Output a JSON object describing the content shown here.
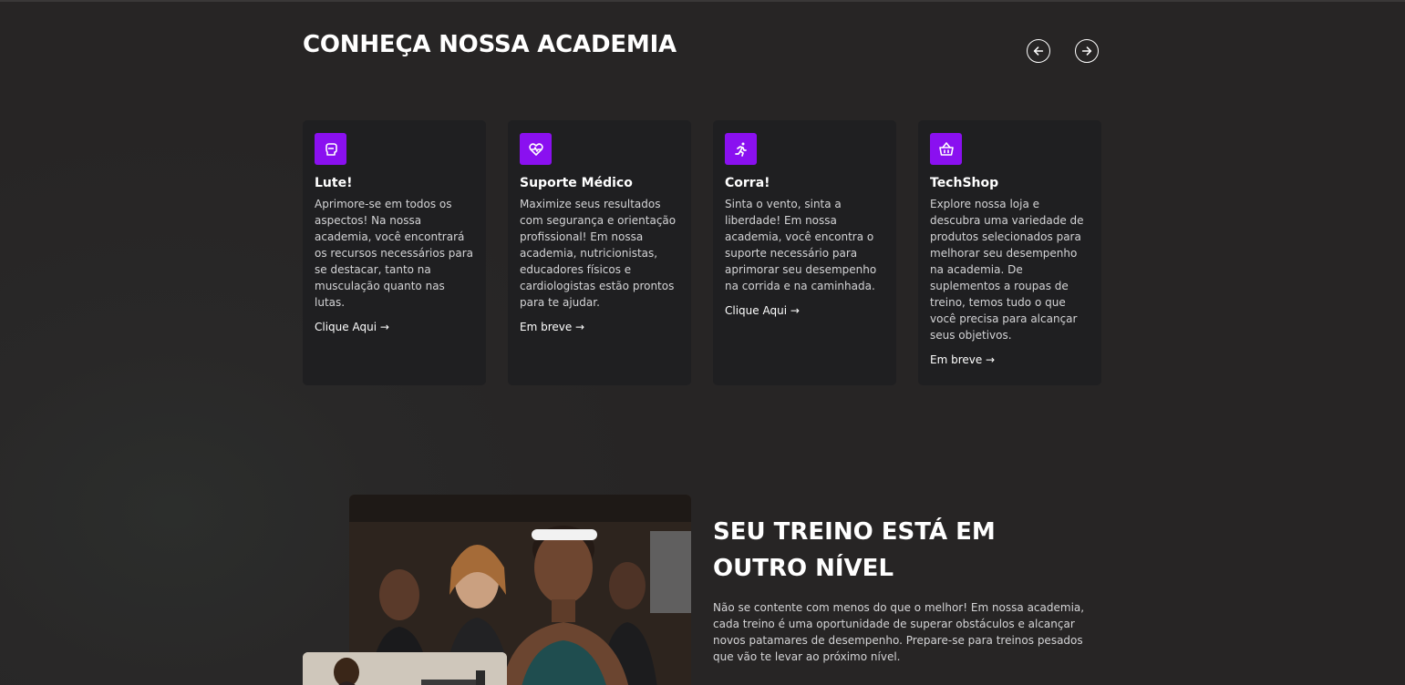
{
  "section": {
    "title": "CONHEÇA NOSSA ACADEMIA"
  },
  "carousel": {
    "prev_icon": "arrow-left-icon",
    "next_icon": "arrow-right-icon"
  },
  "cards": [
    {
      "icon": "boxing-glove-icon",
      "title": "Lute!",
      "text": "Aprimore-se em todos os aspectos! Na nossa academia, você encontrará os recursos necessários para se destacar, tanto na musculação quanto nas lutas.",
      "link": "Clique Aqui →"
    },
    {
      "icon": "heart-pulse-icon",
      "title": "Suporte Médico",
      "text": "Maximize seus resultados com segurança e orientação profissional! Em nossa academia, nutricionistas, educadores físicos e cardiologistas estão prontos para te ajudar.",
      "link": "Em breve →"
    },
    {
      "icon": "running-person-icon",
      "title": "Corra!",
      "text": "Sinta o vento, sinta a liberdade! Em nossa academia, você encontra o suporte necessário para aprimorar seu desempenho na corrida e na caminhada.",
      "link": "Clique Aqui →"
    },
    {
      "icon": "shopping-basket-icon",
      "title": "TechShop",
      "text": "Explore nossa loja e descubra uma variedade de produtos selecionados para melhorar seu desempenho na academia. De suplementos a roupas de treino, temos tudo o que você precisa para alcançar seus objetivos.",
      "link": "Em breve →"
    }
  ],
  "promo": {
    "title": "SEU TREINO ESTÁ EM OUTRO NÍVEL",
    "text": "Não se contente com menos do que o melhor! Em nossa academia, cada treino é uma oportunidade de superar obstáculos e alcançar novos patamares de desempenho. Prepare-se para treinos pesados que vão te levar ao próximo nível."
  },
  "colors": {
    "background": "#272525",
    "card": "#1f1f21",
    "accent": "#8a10f0"
  }
}
